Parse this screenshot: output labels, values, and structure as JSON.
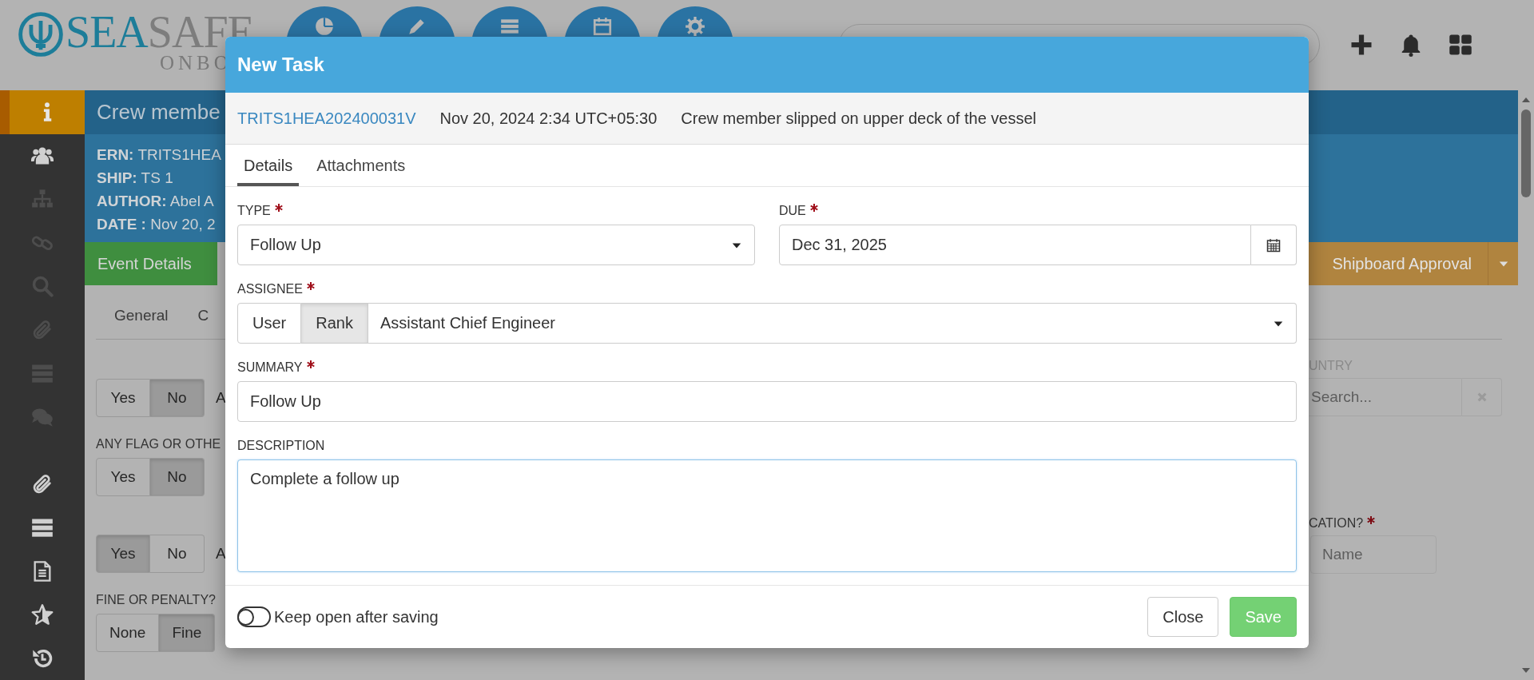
{
  "app_header": {
    "logo": {
      "primary": "SEA",
      "secondary": "SAFE",
      "tagline": "ONBO"
    },
    "nav_buttons": [
      {
        "kind": "chart"
      },
      {
        "kind": "edit"
      },
      {
        "kind": "list"
      },
      {
        "kind": "calendar"
      },
      {
        "kind": "settings"
      }
    ],
    "actions": [
      {
        "kind": "add"
      },
      {
        "kind": "notifications"
      },
      {
        "kind": "apps"
      }
    ]
  },
  "sidebar": {
    "items": [
      {
        "kind": "info",
        "selected": true,
        "disabled": false
      },
      {
        "kind": "users",
        "selected": false,
        "disabled": false
      },
      {
        "kind": "sitemap",
        "selected": false,
        "disabled": true
      },
      {
        "kind": "link",
        "selected": false,
        "disabled": true
      },
      {
        "kind": "search",
        "selected": false,
        "disabled": true
      },
      {
        "kind": "paperclip",
        "selected": false,
        "disabled": true
      },
      {
        "kind": "server",
        "selected": false,
        "disabled": true
      },
      {
        "kind": "comments",
        "selected": false,
        "disabled": true
      },
      {
        "kind": "paperclip",
        "selected": false,
        "disabled": false,
        "group_start": true
      },
      {
        "kind": "server",
        "selected": false,
        "disabled": false
      },
      {
        "kind": "file",
        "selected": false,
        "disabled": false
      },
      {
        "kind": "star",
        "selected": false,
        "disabled": false
      },
      {
        "kind": "history",
        "selected": false,
        "disabled": false
      }
    ]
  },
  "event": {
    "title": "Crew membe",
    "meta": [
      {
        "label": "ERN:",
        "value": "TRITS1HEA"
      },
      {
        "label": "SHIP:",
        "value": "TS 1"
      },
      {
        "label": "AUTHOR:",
        "value": "Abel A"
      },
      {
        "label": "DATE :",
        "value": "Nov 20, 2"
      }
    ],
    "workflow": [
      {
        "label": "Event Details",
        "color": "#3f8e3f"
      },
      {
        "label": "Shipboard Approval",
        "color": "#b0843f",
        "has_menu": true
      }
    ],
    "tabs": [
      {
        "label": "General"
      },
      {
        "label": "C"
      }
    ],
    "left_rows": [
      {
        "options": [
          {
            "label": "Yes",
            "selected": false
          },
          {
            "label": "No",
            "selected": true
          }
        ],
        "trailing": "A"
      },
      {
        "label": "ANY FLAG OR OTHE",
        "options": [
          {
            "label": "Yes",
            "selected": false
          },
          {
            "label": "No",
            "selected": true
          }
        ]
      },
      {
        "options": [
          {
            "label": "Yes",
            "selected": true
          },
          {
            "label": "No",
            "selected": false
          }
        ],
        "trailing": "A"
      },
      {
        "label": "FINE OR PENALTY?",
        "options": [
          {
            "label": "None",
            "selected": false
          },
          {
            "label": "Fine",
            "selected": true
          }
        ]
      }
    ],
    "right_fields": [
      {
        "label": "UNTRY",
        "required": false,
        "placeholder": "Search...",
        "clearable": true
      },
      {
        "label": "CATION?",
        "required": true,
        "placeholder": "Name",
        "clearable": false
      }
    ]
  },
  "modal": {
    "title": "New Task",
    "reference": "TRITS1HEA202400031V",
    "timestamp": "Nov 20, 2024 2:34 UTC+05:30",
    "event_summary": "Crew member slipped on upper deck of the vessel",
    "tabs": [
      {
        "label": "Details",
        "selected": true
      },
      {
        "label": "Attachments",
        "selected": false
      }
    ],
    "type": {
      "label": "TYPE",
      "required": true,
      "value": "Follow Up"
    },
    "due": {
      "label": "DUE",
      "required": true,
      "value": "Dec 31, 2025"
    },
    "assignee": {
      "label": "ASSIGNEE",
      "required": true,
      "modes": [
        {
          "label": "User",
          "selected": false
        },
        {
          "label": "Rank",
          "selected": true
        }
      ],
      "value": "Assistant Chief Engineer"
    },
    "summary": {
      "label": "SUMMARY",
      "required": true,
      "value": "Follow Up"
    },
    "description": {
      "label": "DESCRIPTION",
      "required": false,
      "value": "Complete a follow up",
      "focused": true
    },
    "keep_open": {
      "label": "Keep open after saving",
      "on": false
    },
    "buttons": [
      {
        "label": "Close",
        "kind": "default"
      },
      {
        "label": "Save",
        "kind": "primary"
      }
    ]
  }
}
